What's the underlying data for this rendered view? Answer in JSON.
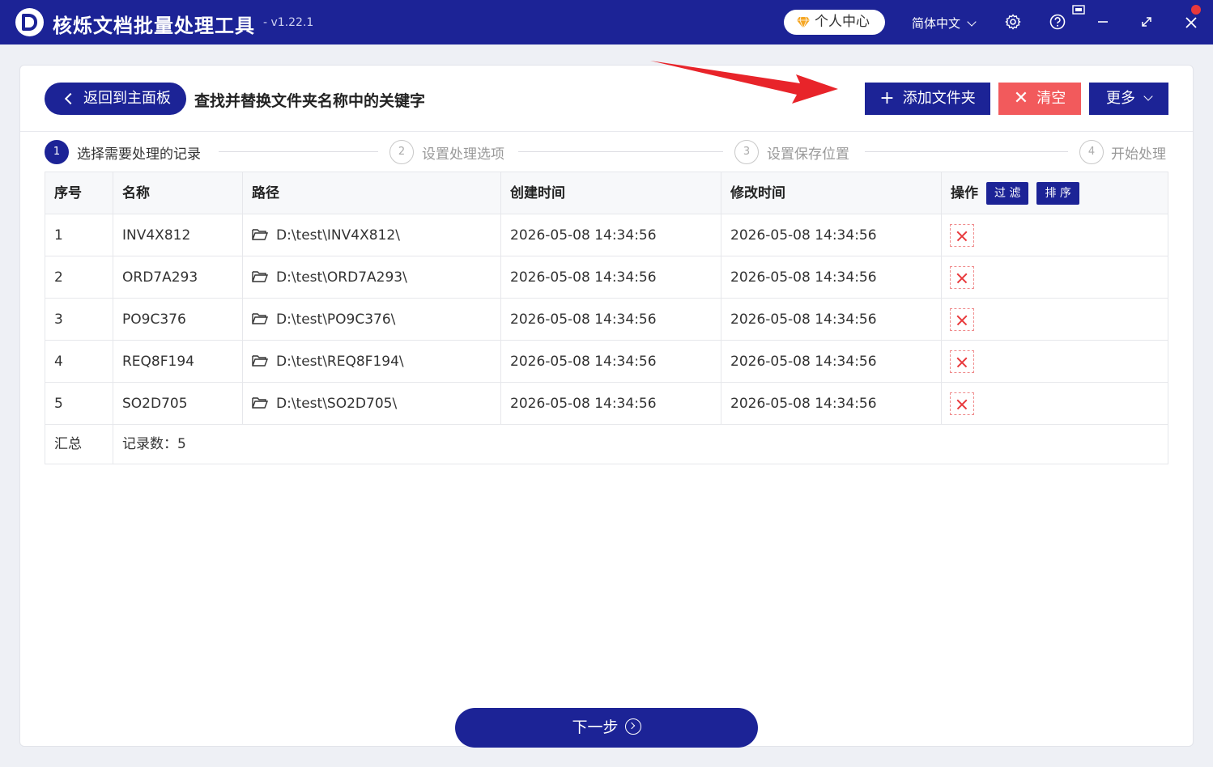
{
  "titlebar": {
    "app_title": "核烁文档批量处理工具",
    "version": "- v1.22.1",
    "user_center": "个人中心",
    "language": "简体中文",
    "brand_color": "#1c2396"
  },
  "toolbar": {
    "back_label": "返回到主面板",
    "page_title": "查找并替换文件夹名称中的关键字",
    "add_folder_label": "添加文件夹",
    "clear_label": "清空",
    "more_label": "更多",
    "clear_color": "#f25a5c"
  },
  "steps": [
    {
      "num": "1",
      "label": "选择需要处理的记录",
      "active": true
    },
    {
      "num": "2",
      "label": "设置处理选项",
      "active": false
    },
    {
      "num": "3",
      "label": "设置保存位置",
      "active": false
    },
    {
      "num": "4",
      "label": "开始处理",
      "active": false
    }
  ],
  "table": {
    "headers": [
      "序号",
      "名称",
      "路径",
      "创建时间",
      "修改时间",
      "操作"
    ],
    "filter_label": "过 滤",
    "sort_label": "排 序",
    "rows": [
      {
        "index": "1",
        "name": "INV4X812",
        "path": "D:\\test\\INV4X812\\",
        "created": "2026-05-08 14:34:56",
        "modified": "2026-05-08 14:34:56"
      },
      {
        "index": "2",
        "name": "ORD7A293",
        "path": "D:\\test\\ORD7A293\\",
        "created": "2026-05-08 14:34:56",
        "modified": "2026-05-08 14:34:56"
      },
      {
        "index": "3",
        "name": "PO9C376",
        "path": "D:\\test\\PO9C376\\",
        "created": "2026-05-08 14:34:56",
        "modified": "2026-05-08 14:34:56"
      },
      {
        "index": "4",
        "name": "REQ8F194",
        "path": "D:\\test\\REQ8F194\\",
        "created": "2026-05-08 14:34:56",
        "modified": "2026-05-08 14:34:56"
      },
      {
        "index": "5",
        "name": "SO2D705",
        "path": "D:\\test\\SO2D705\\",
        "created": "2026-05-08 14:34:56",
        "modified": "2026-05-08 14:34:56"
      }
    ],
    "summary_label": "汇总",
    "summary_value": "记录数：5"
  },
  "footer": {
    "next_label": "下一步"
  },
  "icons": [
    "app-logo",
    "diamond-icon",
    "chevron-down-icon",
    "gear-icon",
    "help-icon",
    "pin-icon",
    "minimize-icon",
    "maximize-icon",
    "close-icon",
    "folder-icon",
    "delete-icon",
    "red-arrow-annotation"
  ]
}
